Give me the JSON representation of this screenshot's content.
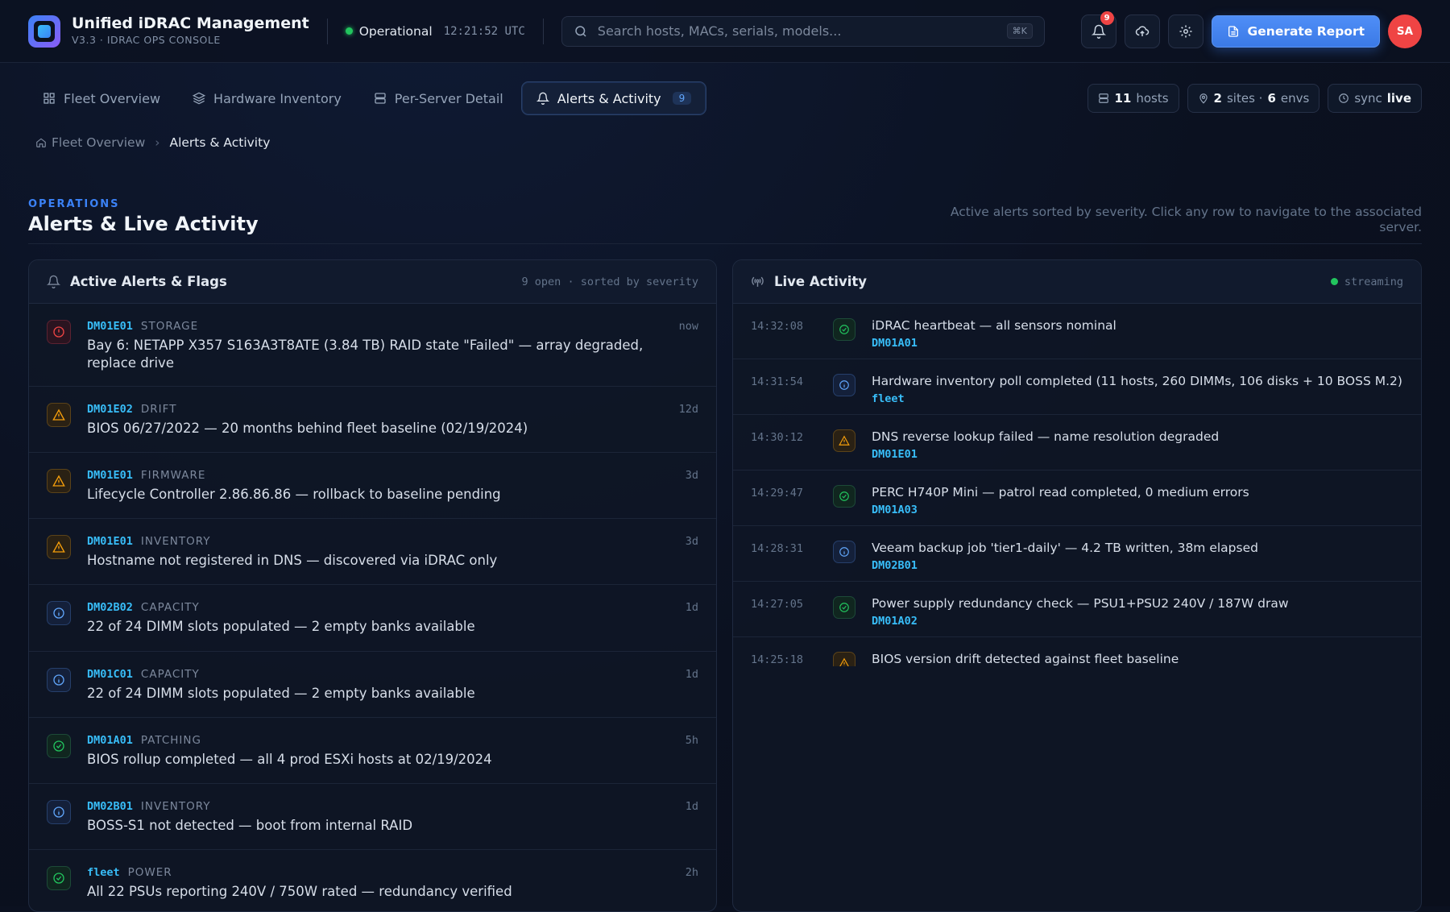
{
  "header": {
    "title": "Unified iDRAC Management",
    "subtitle": "V3.3 · IDRAC OPS CONSOLE",
    "status_label": "Operational",
    "status_time": "12:21:52 UTC",
    "search_placeholder": "Search hosts, MACs, serials, models...",
    "search_shortcut": "⌘K",
    "notification_count": "9",
    "report_button": "Generate Report",
    "avatar_initials": "SA"
  },
  "tabs": [
    {
      "label": "Fleet Overview",
      "icon": "grid-icon",
      "active": false
    },
    {
      "label": "Hardware Inventory",
      "icon": "layers-icon",
      "active": false
    },
    {
      "label": "Per-Server Detail",
      "icon": "server-icon",
      "active": false
    },
    {
      "label": "Alerts & Activity",
      "icon": "bell-icon",
      "active": true,
      "count": "9"
    }
  ],
  "chips": {
    "hosts_count": "11",
    "hosts_label": "hosts",
    "sites_count": "2",
    "sites_label": "sites ·",
    "envs_count": "6",
    "envs_label": "envs",
    "sync_label": "sync",
    "sync_value": "live"
  },
  "breadcrumb": {
    "home": "Fleet Overview",
    "separator": "›",
    "current": "Alerts & Activity"
  },
  "page": {
    "eyebrow": "OPERATIONS",
    "title": "Alerts & Live Activity",
    "description": "Active alerts sorted by severity. Click any row to navigate to the associated server."
  },
  "alerts_panel": {
    "title": "Active Alerts & Flags",
    "meta": "9 open · sorted by severity",
    "items": [
      {
        "severity": "critical",
        "host": "DM01E01",
        "category": "STORAGE",
        "message": "Bay 6: NETAPP X357 S163A3T8ATE (3.84 TB) RAID state \"Failed\" — array degraded, replace drive",
        "age": "now"
      },
      {
        "severity": "warning",
        "host": "DM01E02",
        "category": "DRIFT",
        "message": "BIOS 06/27/2022 — 20 months behind fleet baseline (02/19/2024)",
        "age": "12d"
      },
      {
        "severity": "warning",
        "host": "DM01E01",
        "category": "FIRMWARE",
        "message": "Lifecycle Controller 2.86.86.86 — rollback to baseline pending",
        "age": "3d"
      },
      {
        "severity": "warning",
        "host": "DM01E01",
        "category": "INVENTORY",
        "message": "Hostname not registered in DNS — discovered via iDRAC only",
        "age": "3d"
      },
      {
        "severity": "info",
        "host": "DM02B02",
        "category": "CAPACITY",
        "message": "22 of 24 DIMM slots populated — 2 empty banks available",
        "age": "1d"
      },
      {
        "severity": "info",
        "host": "DM01C01",
        "category": "CAPACITY",
        "message": "22 of 24 DIMM slots populated — 2 empty banks available",
        "age": "1d"
      },
      {
        "severity": "ok",
        "host": "DM01A01",
        "category": "PATCHING",
        "message": "BIOS rollup completed — all 4 prod ESXi hosts at 02/19/2024",
        "age": "5h"
      },
      {
        "severity": "info",
        "host": "DM02B01",
        "category": "INVENTORY",
        "message": "BOSS-S1 not detected — boot from internal RAID",
        "age": "1d"
      },
      {
        "severity": "ok",
        "host": "fleet",
        "category": "POWER",
        "message": "All 22 PSUs reporting 240V / 750W rated — redundancy verified",
        "age": "2h"
      }
    ]
  },
  "activity_panel": {
    "title": "Live Activity",
    "meta": "streaming",
    "items": [
      {
        "time": "14:32:08",
        "type": "ok",
        "message": "iDRAC heartbeat — all sensors nominal",
        "host": "DM01A01"
      },
      {
        "time": "14:31:54",
        "type": "info",
        "message": "Hardware inventory poll completed (11 hosts, 260 DIMMs, 106 disks + 10 BOSS M.2)",
        "host": "fleet"
      },
      {
        "time": "14:30:12",
        "type": "warning",
        "message": "DNS reverse lookup failed — name resolution degraded",
        "host": "DM01E01"
      },
      {
        "time": "14:29:47",
        "type": "ok",
        "message": "PERC H740P Mini — patrol read completed, 0 medium errors",
        "host": "DM01A03"
      },
      {
        "time": "14:28:31",
        "type": "info",
        "message": "Veeam backup job 'tier1-daily' — 4.2 TB written, 38m elapsed",
        "host": "DM02B01"
      },
      {
        "time": "14:27:05",
        "type": "ok",
        "message": "Power supply redundancy check — PSU1+PSU2 240V / 187W draw",
        "host": "DM01A02"
      },
      {
        "time": "14:25:18",
        "type": "warning",
        "message": "BIOS version drift detected against fleet baseline",
        "host": ""
      }
    ]
  },
  "colors": {
    "accent": "#3b82f6",
    "critical": "#ef4444",
    "warning": "#f59e0b",
    "info": "#60a5fa",
    "ok": "#22c55e",
    "host": "#38bdf8"
  }
}
